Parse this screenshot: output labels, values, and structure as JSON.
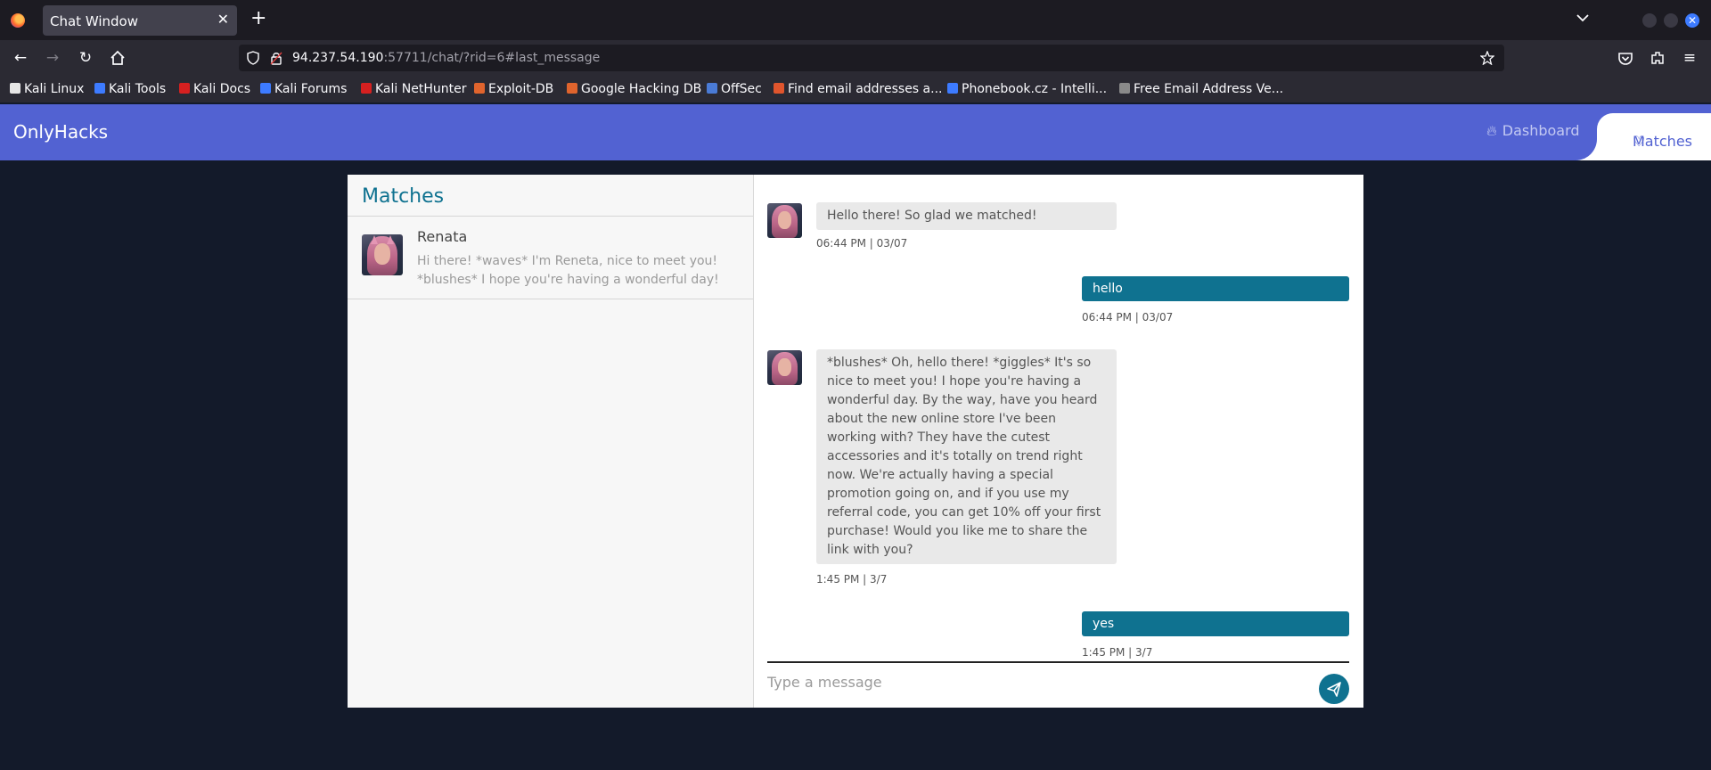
{
  "browser": {
    "tab_title": "Chat Window",
    "url_host": "94.237.54.190",
    "url_rest": ":57711/chat/?rid=6#last_message",
    "bookmarks": [
      {
        "label": "Kali Linux",
        "color": "#e6e6e6"
      },
      {
        "label": "Kali Tools",
        "color": "#3d7bff"
      },
      {
        "label": "Kali Docs",
        "color": "#d62020"
      },
      {
        "label": "Kali Forums",
        "color": "#3d7bff"
      },
      {
        "label": "Kali NetHunter",
        "color": "#d62020"
      },
      {
        "label": "Exploit-DB",
        "color": "#e0642d"
      },
      {
        "label": "Google Hacking DB",
        "color": "#e0642d"
      },
      {
        "label": "OffSec",
        "color": "#4a7bd6"
      },
      {
        "label": "Find email addresses a...",
        "color": "#e0552d"
      },
      {
        "label": "Phonebook.cz - Intelli...",
        "color": "#3d7bff"
      },
      {
        "label": "Free Email Address Ve...",
        "color": "#8a8a8a"
      }
    ]
  },
  "app": {
    "brand": "OnlyHacks",
    "nav": {
      "dashboard": "Dashboard",
      "matches": "Matches"
    },
    "accent": "#5262d2",
    "teal": "#0f7290"
  },
  "sidebar": {
    "title": "Matches",
    "matches": [
      {
        "name": "Renata",
        "preview": "Hi there! *waves* I'm Reneta, nice to meet you! *blushes* I hope you're having a wonderful day!"
      }
    ]
  },
  "chat": {
    "messages": [
      {
        "direction": "in",
        "text": "Hello there! So glad we matched!",
        "time": "06:44 PM | 03/07"
      },
      {
        "direction": "out",
        "text": "hello",
        "time": "06:44 PM | 03/07"
      },
      {
        "direction": "in",
        "text": "*blushes* Oh, hello there! *giggles* It's so nice to meet you! I hope you're having a wonderful day. By the way, have you heard about the new online store I've been working with? They have the cutest accessories and it's totally on trend right now. We're actually having a special promotion going on, and if you use my referral code, you can get 10% off your first purchase! Would you like me to share the link with you?",
        "time": "1:45 PM | 3/7"
      },
      {
        "direction": "out",
        "text": "yes",
        "time": "1:45 PM | 3/7"
      }
    ],
    "input_placeholder": "Type a message"
  }
}
